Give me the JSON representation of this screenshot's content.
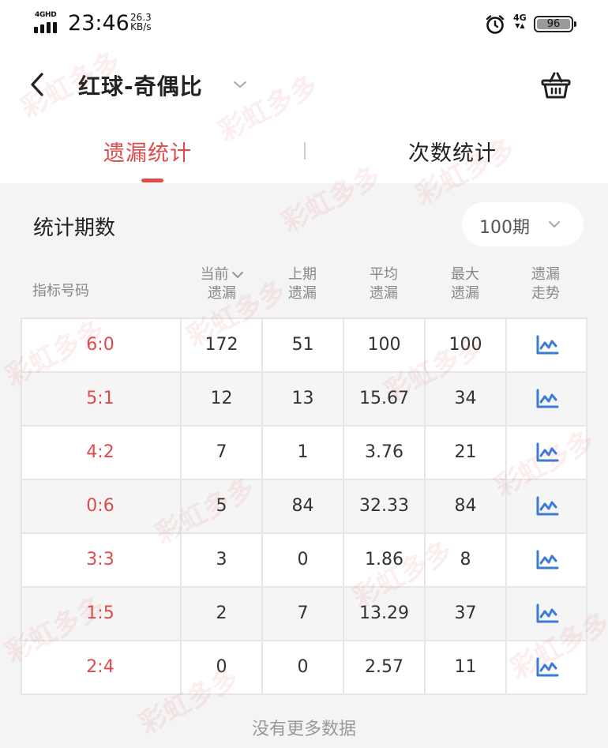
{
  "status_bar": {
    "network_type": "4GHD",
    "time": "23:46",
    "speed_value": "26.3",
    "speed_unit": "KB/s",
    "mobile_data": "4G",
    "battery": "96"
  },
  "header": {
    "title": "红球-奇偶比"
  },
  "tabs": [
    {
      "label": "遗漏统计",
      "active": true
    },
    {
      "label": "次数统计",
      "active": false
    }
  ],
  "period": {
    "label": "统计期数",
    "value": "100期"
  },
  "table": {
    "headers": [
      {
        "line1": "指标号码",
        "line2": ""
      },
      {
        "line1": "当前",
        "line2": "遗漏"
      },
      {
        "line1": "上期",
        "line2": "遗漏"
      },
      {
        "line1": "平均",
        "line2": "遗漏"
      },
      {
        "line1": "最大",
        "line2": "遗漏"
      },
      {
        "line1": "遗漏",
        "line2": "走势"
      }
    ],
    "rows": [
      {
        "ratio": "6:0",
        "current": "172",
        "last": "51",
        "avg": "100",
        "max": "100"
      },
      {
        "ratio": "5:1",
        "current": "12",
        "last": "13",
        "avg": "15.67",
        "max": "34"
      },
      {
        "ratio": "4:2",
        "current": "7",
        "last": "1",
        "avg": "3.76",
        "max": "21"
      },
      {
        "ratio": "0:6",
        "current": "5",
        "last": "84",
        "avg": "32.33",
        "max": "84"
      },
      {
        "ratio": "3:3",
        "current": "3",
        "last": "0",
        "avg": "1.86",
        "max": "8"
      },
      {
        "ratio": "1:5",
        "current": "2",
        "last": "7",
        "avg": "13.29",
        "max": "37"
      },
      {
        "ratio": "2:4",
        "current": "0",
        "last": "0",
        "avg": "2.57",
        "max": "11"
      }
    ]
  },
  "footer": {
    "no_more": "没有更多数据"
  },
  "watermark": "彩虹多多",
  "colors": {
    "accent": "#e04a4a",
    "trend_icon": "#3a7bd5"
  },
  "icons": {
    "back": "back-arrow-icon",
    "title_dropdown": "chevron-down-icon",
    "basket": "basket-icon",
    "period_dropdown": "chevron-down-icon",
    "sort": "chevron-down-icon",
    "trend": "line-chart-icon",
    "alarm": "alarm-clock-icon"
  }
}
